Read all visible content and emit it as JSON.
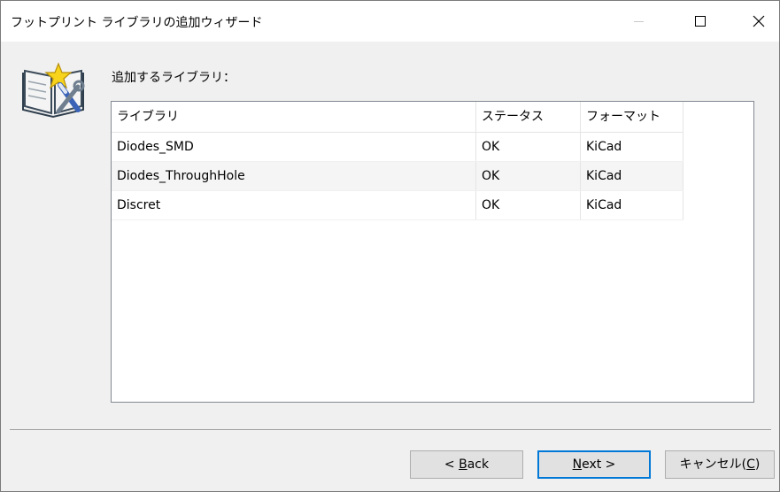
{
  "window": {
    "title": "フットプリント ライブラリの追加ウィザード",
    "controls": {
      "minimize": "minimize",
      "maximize": "maximize",
      "close": "close"
    }
  },
  "main": {
    "section_label": "追加するライブラリ：",
    "wizard_icon": "wizard-book-icon",
    "table": {
      "columns": [
        "ライブラリ",
        "ステータス",
        "フォーマット"
      ],
      "rows": [
        {
          "library": "Diodes_SMD",
          "status": "OK",
          "format": "KiCad"
        },
        {
          "library": "Diodes_ThroughHole",
          "status": "OK",
          "format": "KiCad"
        },
        {
          "library": "Discret",
          "status": "OK",
          "format": "KiCad"
        }
      ]
    }
  },
  "buttons": {
    "back": {
      "prefix": "< ",
      "mnemonic": "B",
      "rest": "ack"
    },
    "next": {
      "mnemonic": "N",
      "rest": "ext >"
    },
    "cancel": {
      "text": "キャンセル(",
      "mnemonic": "C",
      "suffix": ")"
    }
  }
}
